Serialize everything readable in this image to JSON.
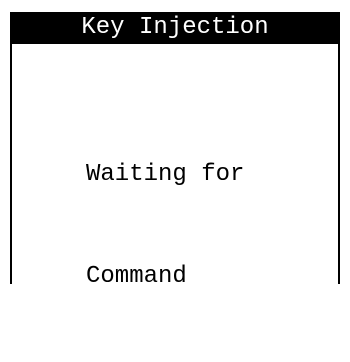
{
  "screen": {
    "title": "Key Injection",
    "message_line1": "Waiting for",
    "message_line2": "Command"
  },
  "colors": {
    "title_bg": "#000000",
    "title_fg": "#ffffff",
    "text": "#000000",
    "background": "#ffffff"
  }
}
